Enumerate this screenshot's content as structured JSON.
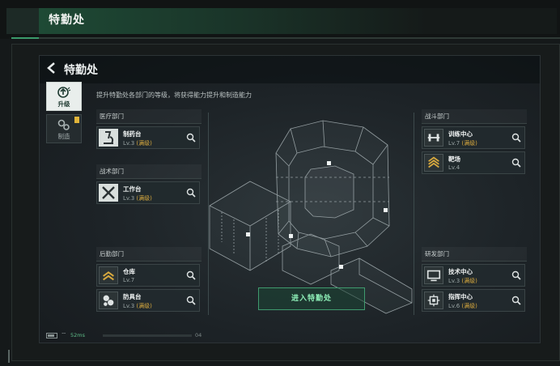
{
  "page": {
    "title": "特勤处"
  },
  "game": {
    "title": "特勤处",
    "subtitle": "提升特勤处各部门的等级，将获得能力提升和制造能力",
    "enter_button": "进入特勤处",
    "tabs": [
      {
        "label": "升级",
        "icon": "upgrade-arrow-icon",
        "active": true
      },
      {
        "label": "制造",
        "icon": "gears-icon",
        "active": false
      }
    ],
    "departments": {
      "medical": {
        "title": "医疗部门",
        "facilities": [
          {
            "name": "制药台",
            "level": "Lv.3",
            "status": "(满级)",
            "icon": "microscope-icon"
          }
        ]
      },
      "tactical": {
        "title": "战术部门",
        "facilities": [
          {
            "name": "工作台",
            "level": "Lv.3",
            "status": "(满级)",
            "icon": "tools-icon"
          }
        ]
      },
      "logistics": {
        "title": "后勤部门",
        "facilities": [
          {
            "name": "仓库",
            "level": "Lv.7",
            "status": "",
            "icon": "chevrons-icon"
          },
          {
            "name": "防具台",
            "level": "Lv.3",
            "status": "(满级)",
            "icon": "armor-icon"
          }
        ]
      },
      "combat": {
        "title": "战斗部门",
        "facilities": [
          {
            "name": "训练中心",
            "level": "Lv.7",
            "status": "(满级)",
            "icon": "dumbbell-icon"
          },
          {
            "name": "靶场",
            "level": "Lv.4",
            "status": "",
            "icon": "rank-chevrons-icon"
          }
        ]
      },
      "research": {
        "title": "研发部门",
        "facilities": [
          {
            "name": "技术中心",
            "level": "Lv.3",
            "status": "(满级)",
            "icon": "monitor-icon"
          },
          {
            "name": "指挥中心",
            "level": "Lv.6",
            "status": "(满级)",
            "icon": "chip-icon"
          }
        ]
      }
    },
    "status_bar": {
      "ping": "52ms",
      "progress_label": "04"
    }
  },
  "colors": {
    "accent_green": "#3f9a6e",
    "maxed_gold": "#d8a93e",
    "badge_yellow": "#e0b43a"
  }
}
